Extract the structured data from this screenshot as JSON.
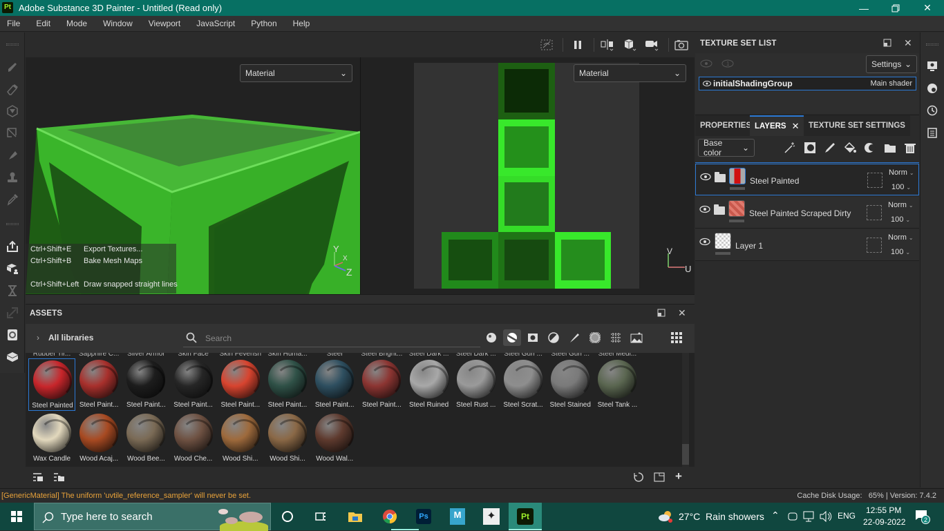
{
  "window": {
    "app_icon": "Pt",
    "title": "Adobe Substance 3D Painter - Untitled (Read only)",
    "minimize_icon": "minimize-icon",
    "restore_icon": "restore-icon",
    "close_icon": "close-icon"
  },
  "menu": [
    "File",
    "Edit",
    "Mode",
    "Window",
    "Viewport",
    "JavaScript",
    "Python",
    "Help"
  ],
  "left_tools": [
    "paint-brush-icon",
    "eraser-icon",
    "projection-icon",
    "polygon-fill-icon",
    "smudge-icon",
    "clone-stamp-icon",
    "color-picker-icon",
    "export-icon",
    "bake-icon",
    "history-icon",
    "resize-icon",
    "iray-icon",
    "mesh-icon"
  ],
  "viewport_toolbar": [
    "hide-icon",
    "pause-icon",
    "split-view-icon",
    "display-mode-icon",
    "camera-icon",
    "screenshot-icon"
  ],
  "viewport3d": {
    "channel_select": "Material",
    "hints": [
      {
        "keys": "Ctrl+Shift+E",
        "action": "Export Textures..."
      },
      {
        "keys": "Ctrl+Shift+B",
        "action": "Bake Mesh Maps"
      },
      {
        "keys": "Ctrl+Shift+Left",
        "action": "Draw snapped straight lines"
      }
    ],
    "axis": {
      "y": "Y",
      "x": "X",
      "z": "Z"
    }
  },
  "viewport2d": {
    "channel_select": "Material",
    "axis": {
      "v": "V",
      "u": "U"
    }
  },
  "texture_set_list": {
    "title": "TEXTURE SET LIST",
    "settings_label": "Settings",
    "items": [
      {
        "name": "initialShadingGroup",
        "shader": "Main shader"
      }
    ]
  },
  "layers_panel": {
    "tabs": [
      "PROPERTIES",
      "LAYERS",
      "TEXTURE SET SETTINGS"
    ],
    "active_tab": "LAYERS",
    "channel": "Base color",
    "tools": [
      "add-effect-icon",
      "add-mask-icon",
      "add-paint-layer-icon",
      "add-fill-layer-icon",
      "add-smart-material-icon",
      "add-folder-icon",
      "delete-icon"
    ],
    "layers": [
      {
        "name": "Steel Painted",
        "blend": "Norm",
        "opacity": "100",
        "selected": true,
        "folder": true
      },
      {
        "name": "Steel Painted Scraped Dirty",
        "blend": "Norm",
        "opacity": "100",
        "selected": false,
        "folder": true
      },
      {
        "name": "Layer 1",
        "blend": "Norm",
        "opacity": "100",
        "selected": false,
        "folder": false
      }
    ]
  },
  "right_strip": [
    "display-settings-icon",
    "shader-settings-icon",
    "history-icon",
    "log-icon"
  ],
  "assets": {
    "title": "ASSETS",
    "library": "All libraries",
    "search_placeholder": "Search",
    "filters": [
      "materials-icon",
      "smart-materials-icon",
      "alphas-icon",
      "grunges-icon",
      "brushes-icon",
      "textures-icon",
      "procedurals-icon",
      "environments-icon"
    ],
    "active_filter": 1,
    "top_row_labels": [
      "Rubber Tir...",
      "Sapphire C...",
      "Silver Armor",
      "Skin Face",
      "Skin Feverish",
      "Skin Huma...",
      "Steel",
      "Steel Bright...",
      "Steel Dark ...",
      "Steel Dark ...",
      "Steel Gun ...",
      "Steel Gun ...",
      "Steel Medi..."
    ],
    "items": [
      {
        "label": "Steel Painted",
        "color": "#c8262b",
        "selected": true
      },
      {
        "label": "Steel Paint...",
        "color": "#a8302c"
      },
      {
        "label": "Steel Paint...",
        "color": "#1d1d1d"
      },
      {
        "label": "Steel Paint...",
        "color": "#262626"
      },
      {
        "label": "Steel Paint...",
        "color": "#d8442f"
      },
      {
        "label": "Steel Paint...",
        "color": "#2f5147"
      },
      {
        "label": "Steel Paint...",
        "color": "#2e4f60"
      },
      {
        "label": "Steel Paint...",
        "color": "#8c3532"
      },
      {
        "label": "Steel Ruined",
        "color": "#a8a8a8"
      },
      {
        "label": "Steel Rust ...",
        "color": "#9a9a9a"
      },
      {
        "label": "Steel Scrat...",
        "color": "#8e8e8e"
      },
      {
        "label": "Steel Stained",
        "color": "#7a7a7a"
      },
      {
        "label": "Steel Tank ...",
        "color": "#5a6650"
      },
      {
        "label": "Wax Candle",
        "color": "#e2d8bd"
      },
      {
        "label": "Wood Acaj...",
        "color": "#a84a22"
      },
      {
        "label": "Wood Bee...",
        "color": "#7a6a55"
      },
      {
        "label": "Wood Che...",
        "color": "#6e5142"
      },
      {
        "label": "Wood Shi...",
        "color": "#9e6a3c"
      },
      {
        "label": "Wood Shi...",
        "color": "#8a6846"
      },
      {
        "label": "Wood Wal...",
        "color": "#5e3a2e"
      }
    ],
    "footer_left": [
      "save-query-icon",
      "load-query-icon"
    ],
    "footer_right": [
      "refresh-icon",
      "new-library-icon",
      "add-icon"
    ]
  },
  "status": {
    "message": "[GenericMaterial] The uniform 'uvtile_reference_sampler' will never be set.",
    "message_color": "#e8a23a",
    "cache": "Cache Disk Usage:   65% | Version: 7.4.2"
  },
  "taskbar": {
    "search_placeholder": "Type here to search",
    "apps": [
      "cortana-icon",
      "task-view-icon",
      "file-explorer-icon",
      "chrome-icon",
      "photoshop-icon",
      "maya-icon",
      "zbrush-icon",
      "substance-painter-icon"
    ],
    "weather": "27°C  Rain showers",
    "lang": "ENG",
    "time": "12:55 PM",
    "date": "22-09-2022",
    "notifications": "2"
  }
}
